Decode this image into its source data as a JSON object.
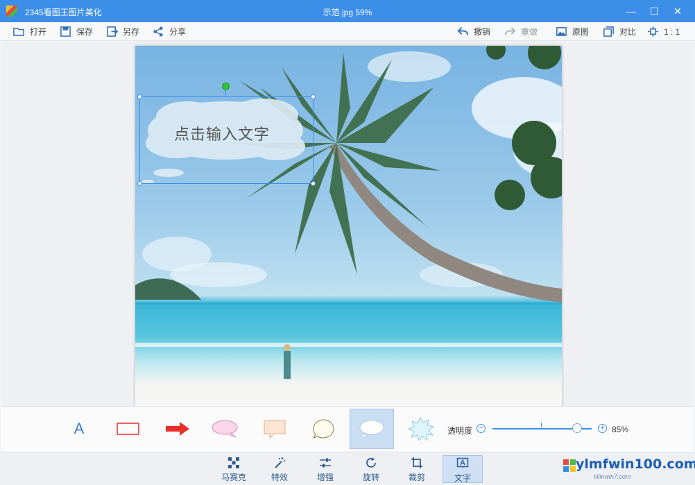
{
  "window": {
    "app_title": "2345看图王图片美化",
    "doc_title": "示范.jpg   59%",
    "minimize_glyph": "—",
    "maximize_glyph": "☐",
    "close_glyph": "✕"
  },
  "toolbar": {
    "open": "打开",
    "save": "保存",
    "save_as": "另存",
    "share": "分享",
    "undo": "撤销",
    "redo": "重做",
    "original": "原图",
    "compare": "对比",
    "actual_size": "1 : 1"
  },
  "canvas": {
    "bubble_text": "点击输入文字"
  },
  "style_panel": {
    "text_style_glyph": "A",
    "opacity_label": "透明度",
    "opacity_value": "85%",
    "opacity_level": 0.85,
    "minus_glyph": "−",
    "plus_glyph": "+"
  },
  "tools": [
    {
      "label": "马赛克",
      "icon": "mosaic-icon"
    },
    {
      "label": "特效",
      "icon": "magic-wand-icon"
    },
    {
      "label": "增强",
      "icon": "sliders-icon"
    },
    {
      "label": "旋转",
      "icon": "rotate-icon"
    },
    {
      "label": "裁剪",
      "icon": "crop-icon"
    },
    {
      "label": "文字",
      "icon": "text-icon"
    }
  ],
  "watermark": {
    "main": "ylmfwin100.com",
    "sub": "Winwin7.com"
  },
  "colors": {
    "accent": "#3d8ee8",
    "arrow_red": "#e8302a",
    "selected_bg": "#c9ddf3"
  }
}
